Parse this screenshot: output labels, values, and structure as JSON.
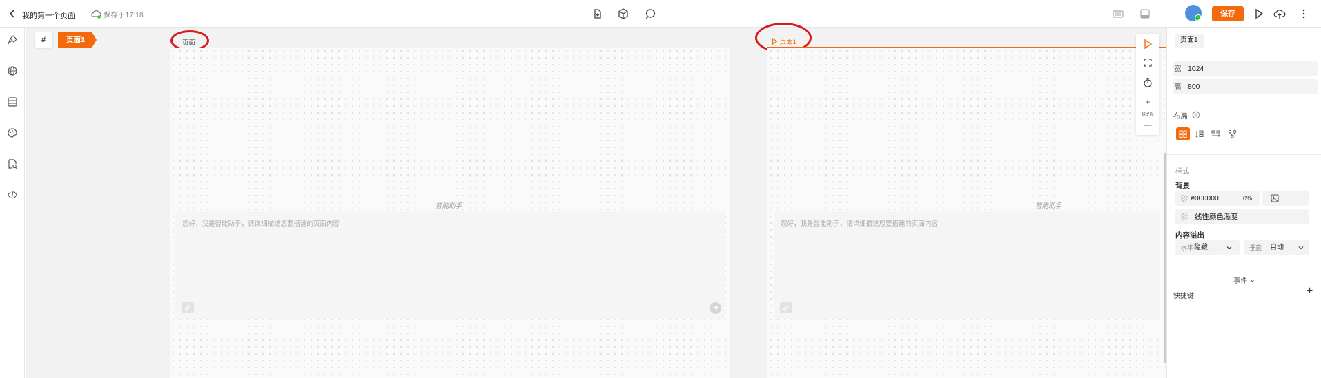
{
  "topbar": {
    "title": "我的第一个页面",
    "saved_text": "保存于17:18",
    "save_label": "保存",
    "colors": {
      "accent": "#f46a0a"
    }
  },
  "left_rail": {
    "icons": [
      "plugin-icon",
      "globe-icon",
      "database-icon",
      "palette-icon",
      "file-search-icon",
      "code-icon"
    ]
  },
  "canvas": {
    "hash_label": "#",
    "page_tab": "页面1",
    "frames": [
      {
        "label": "页面",
        "assistant_title": "智能助手",
        "placeholder": "您好，我是智能助手，请详细描述您要搭建的页面内容"
      },
      {
        "label": "页面1",
        "assistant_title": "智能助手",
        "placeholder": "您好，我是智能助手，请详细描述您要搭建的页面内容"
      }
    ],
    "zoom_plus": "+",
    "zoom": "88%",
    "zoom_minus": "—"
  },
  "right_panel": {
    "chip": "页面1",
    "width_label": "宽",
    "width_value": "1024",
    "height_label": "高",
    "height_value": "800",
    "layout_label": "布局",
    "style_label": "样式",
    "background_label": "背景",
    "bg_color": "#000000",
    "bg_opacity": "0%",
    "gradient_label": "线性颜色渐变",
    "overflow_label": "内容溢出",
    "overflow_h_label": "水平",
    "overflow_h_value": "隐藏...",
    "overflow_v_label": "垂直",
    "overflow_v_value": "自动",
    "events_label": "事件",
    "shortcut_label": "快捷键",
    "add_symbol": "+"
  }
}
